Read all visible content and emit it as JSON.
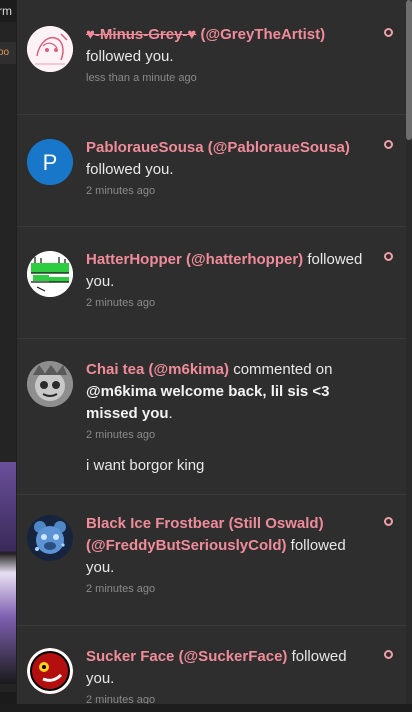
{
  "background": {
    "top_fragment": "rm",
    "side_fragment": "oo"
  },
  "colors": {
    "accent_pink": "#f08c9a",
    "panel_bg": "#2e2e2e",
    "timestamp": "#8a8a8a"
  },
  "notifications": [
    {
      "name_display": "♥-Minus-Grey-♥",
      "handle": "(@GreyTheArtist)",
      "action": "followed you.",
      "time": "less than a minute ago",
      "avatar_icon": "sketch-avatar-icon",
      "unread": true
    },
    {
      "name_display": "PabloraueSousa",
      "handle": "(@PabloraueSousa)",
      "action": "followed you.",
      "time": "2 minutes ago",
      "avatar_letter": "P",
      "avatar_color": "#1877c9",
      "unread": true
    },
    {
      "name_display": "HatterHopper",
      "handle": "(@hatterhopper)",
      "action": "followed you.",
      "time": "2 minutes ago",
      "avatar_icon": "green-hat-avatar-icon",
      "unread": true
    },
    {
      "name_display": "Chai tea",
      "handle": "(@m6kima)",
      "action": "commented on",
      "target": "@m6kima welcome back, lil sis <3 missed you",
      "target_suffix": ".",
      "time": "2 minutes ago",
      "message": "i want borgor king",
      "avatar_icon": "grey-face-avatar-icon",
      "unread": false
    },
    {
      "name_display": "Black Ice Frostbear (Still Oswald)",
      "handle": "(@FreddyButSeriouslyCold)",
      "action": "followed you.",
      "time": "2 minutes ago",
      "avatar_icon": "blue-bear-avatar-icon",
      "unread": true
    },
    {
      "name_display": "Sucker Face",
      "handle": "(@SuckerFace)",
      "action": "followed you.",
      "time": "2 minutes ago",
      "avatar_icon": "red-face-avatar-icon",
      "unread": true
    }
  ]
}
